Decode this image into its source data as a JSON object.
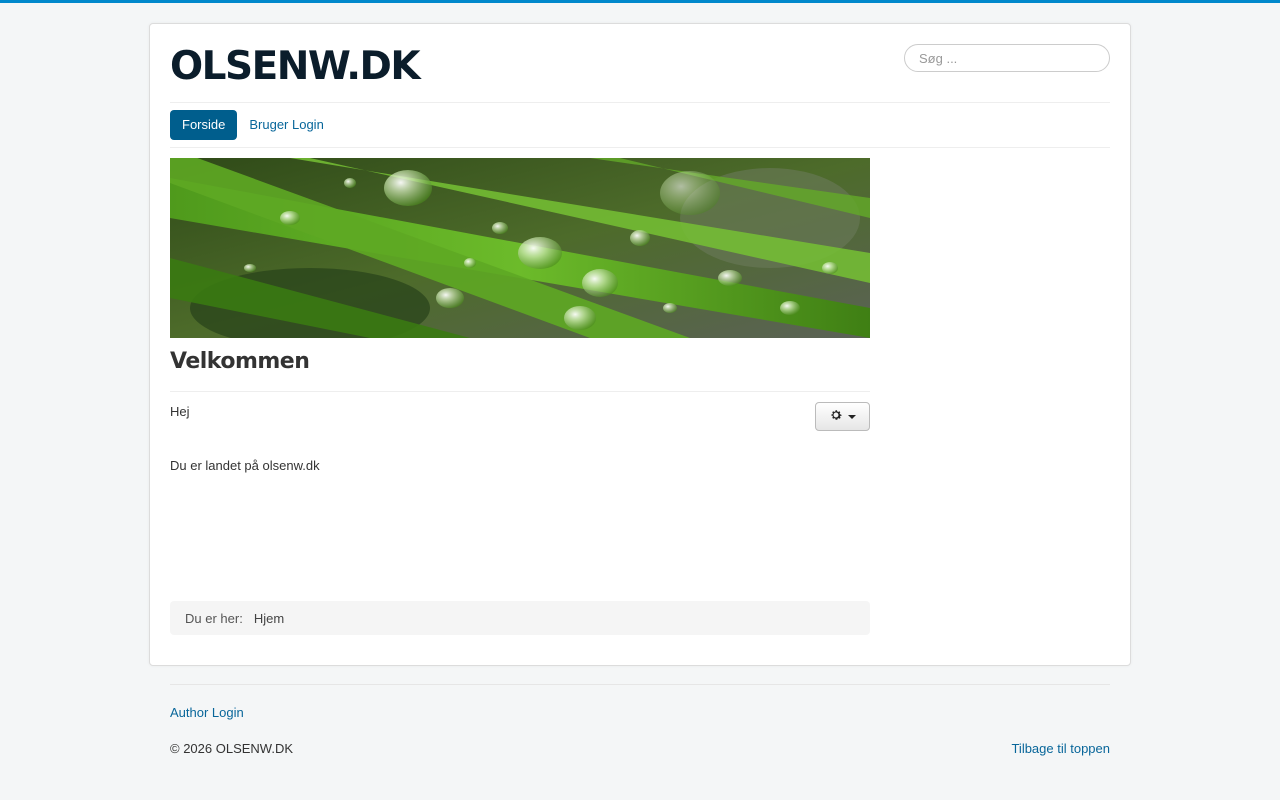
{
  "header": {
    "brand": "OLSENW.DK",
    "search_placeholder": "Søg ..."
  },
  "nav": {
    "items": [
      {
        "label": "Forside",
        "active": true
      },
      {
        "label": "Bruger Login",
        "active": false
      }
    ]
  },
  "banner": {
    "description": "grass-with-water-drops-image"
  },
  "article": {
    "title": "Velkommen",
    "paragraphs": [
      "Hej",
      "Du er landet på olsenw.dk"
    ],
    "tools_icon": "gear-icon"
  },
  "breadcrumb": {
    "label": "Du er her:",
    "items": [
      "Hjem"
    ]
  },
  "footer": {
    "author_login": "Author Login",
    "copyright": "© 2026 OLSENW.DK",
    "back_to_top": "Tilbage til toppen"
  },
  "colors": {
    "accent": "#0088cc",
    "nav_active": "#005e8d",
    "link": "#08669a",
    "background": "#f4f6f7"
  }
}
